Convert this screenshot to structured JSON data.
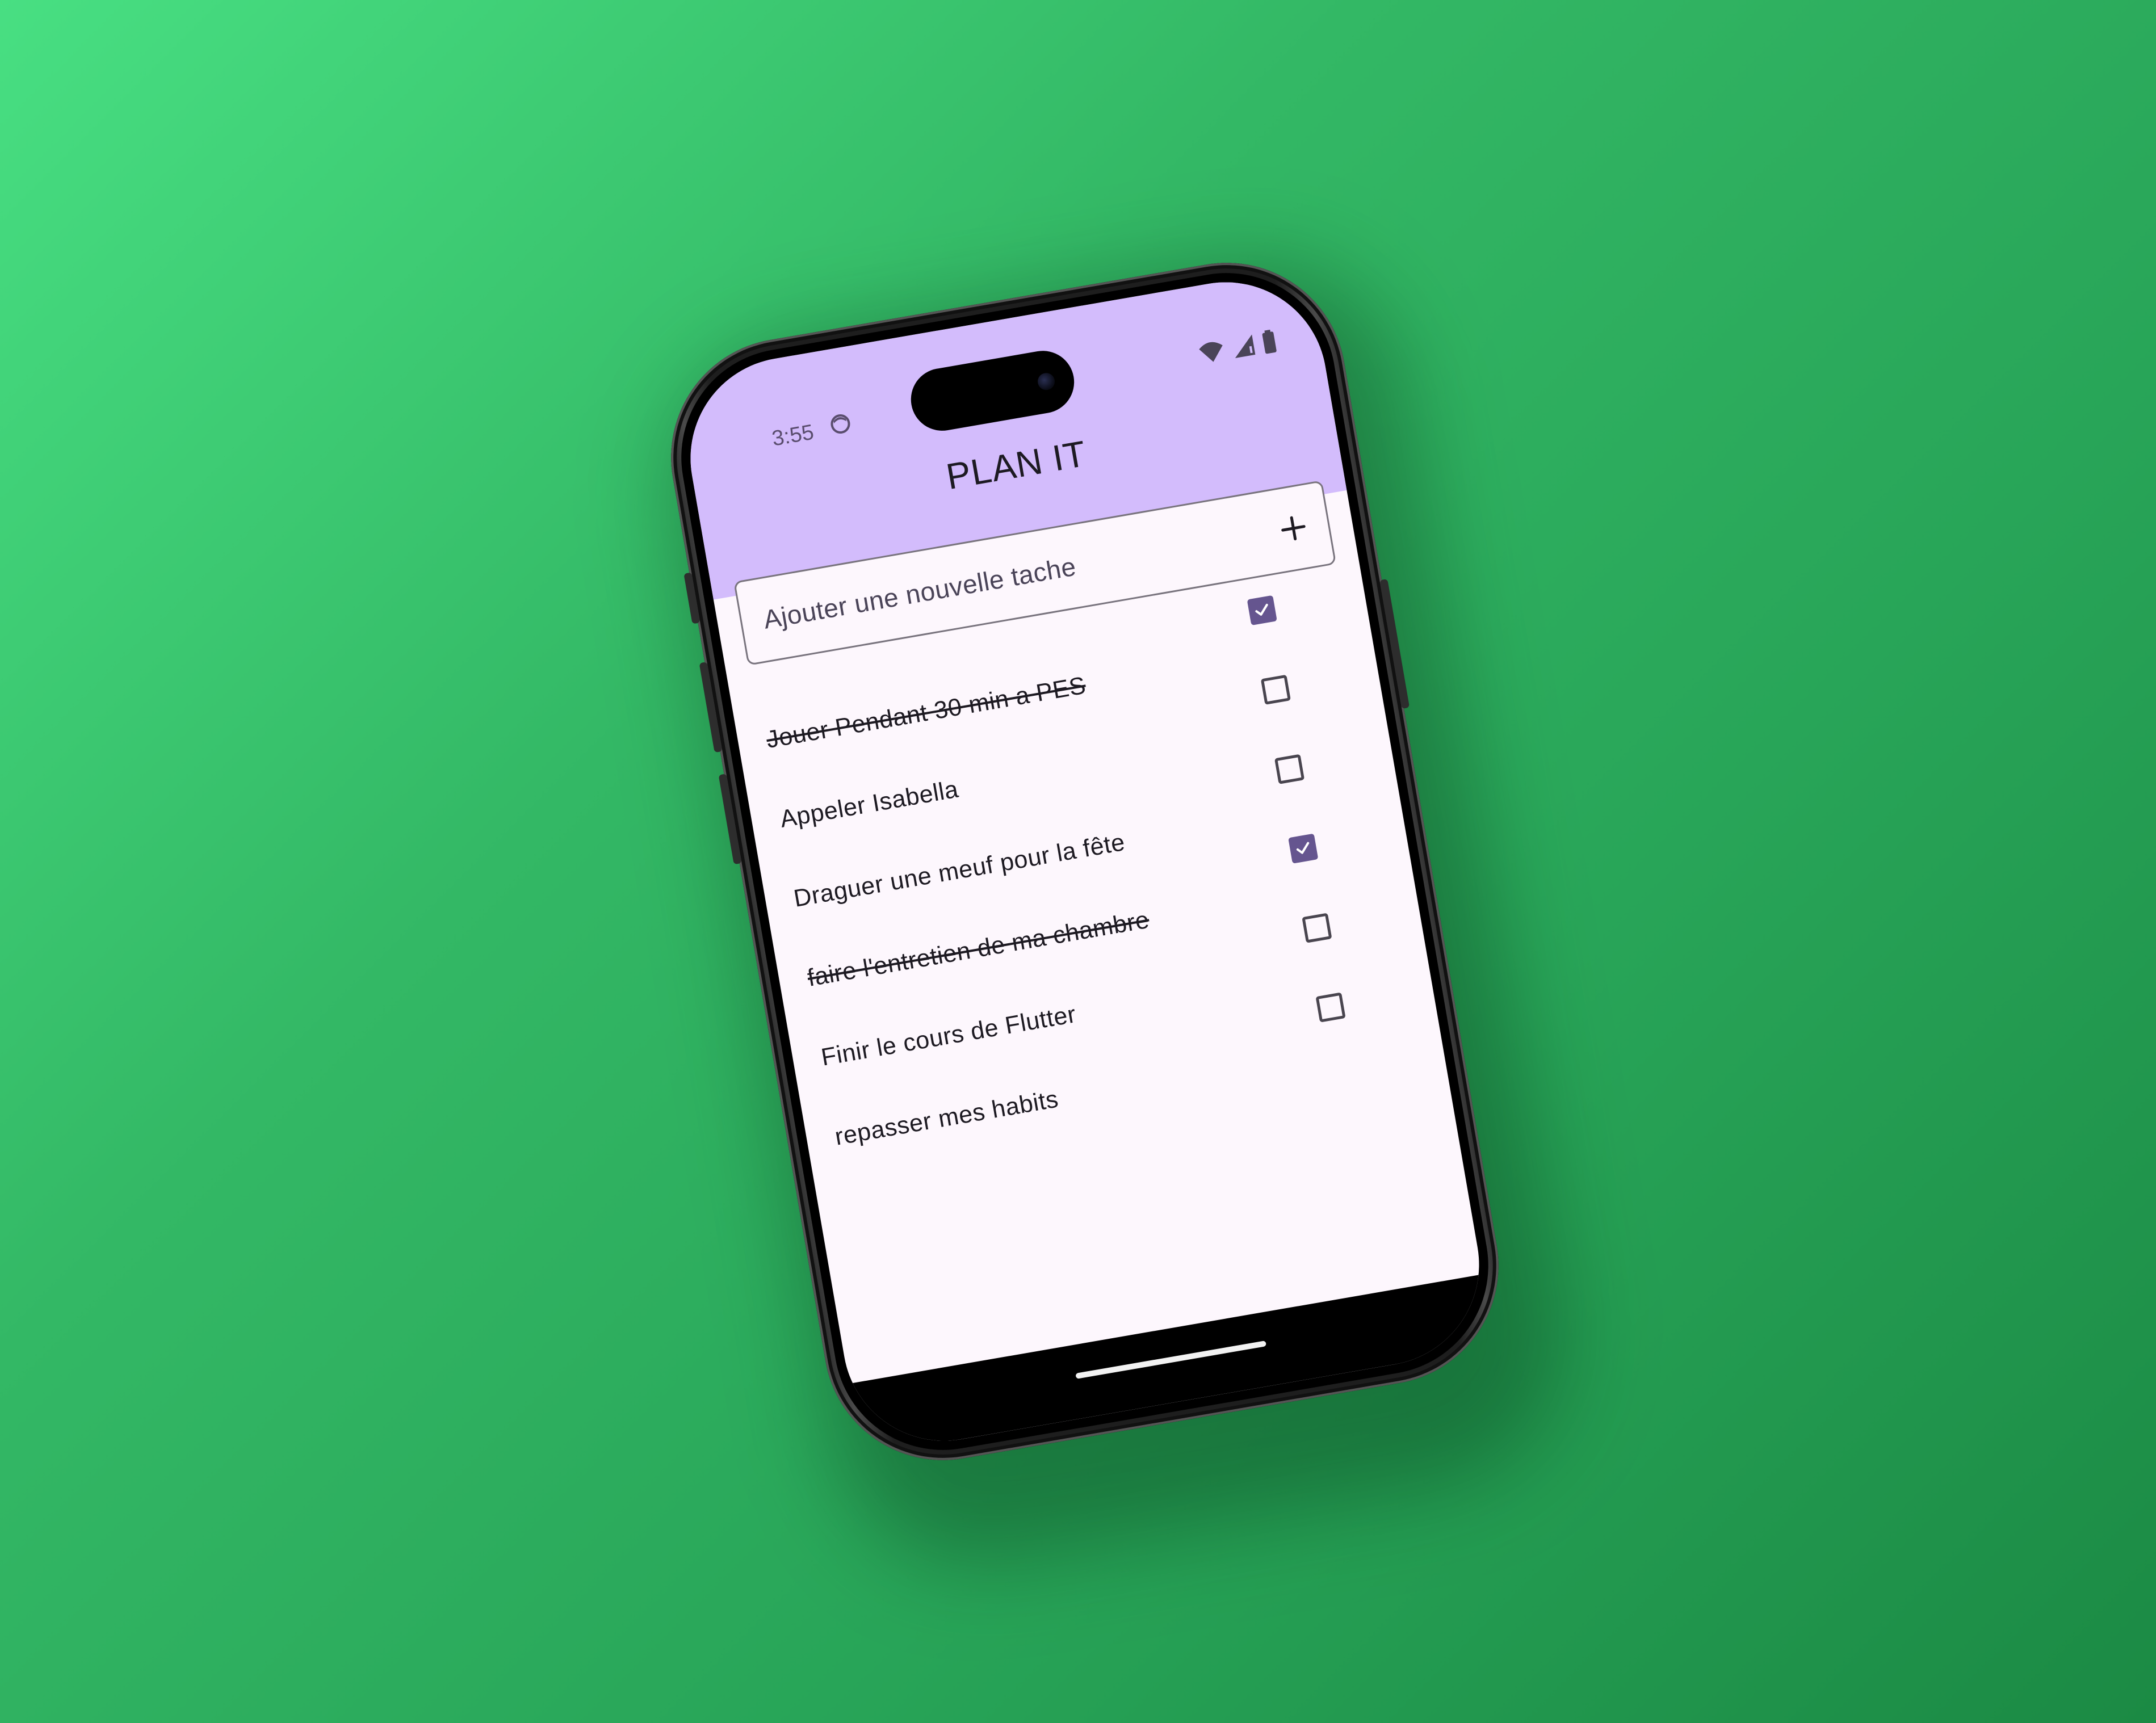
{
  "status_bar": {
    "time": "3:55",
    "icons": [
      "app-notification-icon",
      "wifi-icon",
      "signal-icon",
      "battery-icon"
    ]
  },
  "app": {
    "title": "PLAN IT"
  },
  "new_task": {
    "placeholder": "Ajouter une nouvelle tache",
    "add_icon": "plus-icon"
  },
  "tasks": [
    {
      "label": "Jouer Pendant 30 min a PES",
      "done": true
    },
    {
      "label": "Appeler Isabella",
      "done": false
    },
    {
      "label": "Draguer une meuf pour la fête",
      "done": false
    },
    {
      "label": "faire l'entretien de ma chambre",
      "done": true
    },
    {
      "label": "Finir le cours de Flutter",
      "done": false
    },
    {
      "label": "repasser mes habits",
      "done": false
    }
  ],
  "colors": {
    "background_green": "#33b865",
    "appbar": "#d3bcfc",
    "surface": "#fdf7fd",
    "checkbox_checked": "#65558f",
    "text": "#1d1a22"
  }
}
